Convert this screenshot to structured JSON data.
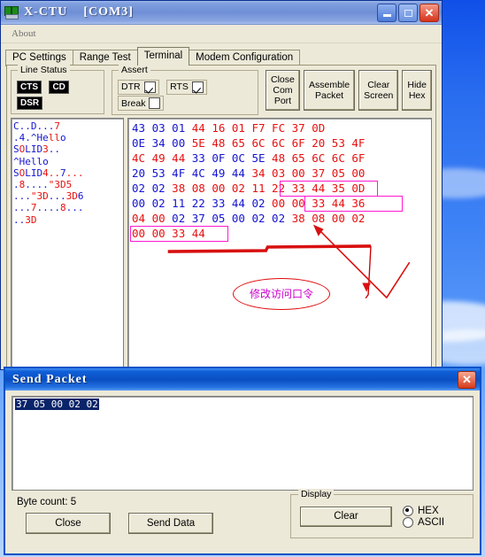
{
  "window": {
    "title": "X-CTU    [COM3]",
    "icon": "modem-icon",
    "buttons": {
      "minimize": "_",
      "maximize": "□",
      "close": "✕"
    }
  },
  "menu": {
    "items": [
      "About"
    ]
  },
  "tabs": [
    {
      "label": "PC Settings",
      "active": false
    },
    {
      "label": "Range Test",
      "active": false
    },
    {
      "label": "Terminal",
      "active": true
    },
    {
      "label": "Modem Configuration",
      "active": false
    }
  ],
  "line_status": {
    "legend": "Line Status",
    "indicators": [
      {
        "label": "CTS",
        "on": false
      },
      {
        "label": "CD",
        "on": false
      },
      {
        "label": "DSR",
        "on": false
      }
    ]
  },
  "assert": {
    "legend": "Assert",
    "items": [
      {
        "label": "DTR",
        "checked": true
      },
      {
        "label": "RTS",
        "checked": true
      },
      {
        "label": "Break",
        "checked": false
      }
    ]
  },
  "toolbar_buttons": [
    {
      "label": "Close\nCom Port"
    },
    {
      "label": "Assemble\nPacket"
    },
    {
      "label": "Clear\nScreen"
    },
    {
      "label": "Hide\nHex"
    }
  ],
  "ascii_pane": {
    "lines": [
      [
        {
          "t": "C..D...",
          "c": "blue"
        },
        {
          "t": "7",
          "c": "red"
        }
      ],
      [
        {
          "t": ".4.^He",
          "c": "blue"
        },
        {
          "t": "ll",
          "c": "red"
        },
        {
          "t": "o",
          "c": "blue"
        }
      ],
      [
        {
          "t": "S",
          "c": "blue"
        },
        {
          "t": "O",
          "c": "red"
        },
        {
          "t": "LID",
          "c": "blue"
        },
        {
          "t": "3",
          "c": "red"
        },
        {
          "t": "..",
          "c": "blue"
        }
      ],
      [
        {
          "t": "^Hello",
          "c": "blue"
        }
      ],
      [
        {
          "t": "S",
          "c": "blue"
        },
        {
          "t": "O",
          "c": "red"
        },
        {
          "t": "LID",
          "c": "blue"
        },
        {
          "t": "4..",
          "c": "red"
        },
        {
          "t": "7",
          "c": "blue"
        },
        {
          "t": "...",
          "c": "red"
        }
      ],
      [
        {
          "t": ".",
          "c": "blue"
        },
        {
          "t": "8",
          "c": "red"
        },
        {
          "t": "....",
          "c": "blue"
        },
        {
          "t": "\"3D5",
          "c": "red"
        }
      ],
      [
        {
          "t": "...",
          "c": "blue"
        },
        {
          "t": "\"3D",
          "c": "red"
        },
        {
          "t": "...",
          "c": "blue"
        },
        {
          "t": "3D",
          "c": "red"
        },
        {
          "t": "6",
          "c": "blue"
        }
      ],
      [
        {
          "t": "...",
          "c": "blue"
        },
        {
          "t": "7",
          "c": "red"
        },
        {
          "t": "....",
          "c": "blue"
        },
        {
          "t": "8",
          "c": "red"
        },
        {
          "t": "...",
          "c": "blue"
        }
      ],
      [
        {
          "t": "..",
          "c": "blue"
        },
        {
          "t": "3D",
          "c": "red"
        }
      ]
    ]
  },
  "hex_pane": {
    "rows": [
      [
        {
          "v": "43",
          "c": "blue"
        },
        {
          "v": "03",
          "c": "blue"
        },
        {
          "v": "01",
          "c": "blue"
        },
        {
          "v": "44",
          "c": "red"
        },
        {
          "v": "16",
          "c": "red"
        },
        {
          "v": "01",
          "c": "red"
        },
        {
          "v": "F7",
          "c": "red"
        },
        {
          "v": "FC",
          "c": "red"
        },
        {
          "v": "37",
          "c": "red"
        },
        {
          "v": "0D",
          "c": "red"
        }
      ],
      [
        {
          "v": "0E",
          "c": "blue"
        },
        {
          "v": "34",
          "c": "blue"
        },
        {
          "v": "00",
          "c": "blue"
        },
        {
          "v": "5E",
          "c": "red"
        },
        {
          "v": "48",
          "c": "red"
        },
        {
          "v": "65",
          "c": "red"
        },
        {
          "v": "6C",
          "c": "red"
        },
        {
          "v": "6C",
          "c": "red"
        },
        {
          "v": "6F",
          "c": "red"
        },
        {
          "v": "20",
          "c": "red"
        },
        {
          "v": "53",
          "c": "red"
        },
        {
          "v": "4F",
          "c": "red"
        }
      ],
      [
        {
          "v": "4C",
          "c": "red"
        },
        {
          "v": "49",
          "c": "red"
        },
        {
          "v": "44",
          "c": "red"
        },
        {
          "v": "33",
          "c": "blue"
        },
        {
          "v": "0F",
          "c": "blue"
        },
        {
          "v": "0C",
          "c": "blue"
        },
        {
          "v": "5E",
          "c": "blue"
        },
        {
          "v": "48",
          "c": "red"
        },
        {
          "v": "65",
          "c": "red"
        },
        {
          "v": "6C",
          "c": "red"
        },
        {
          "v": "6C",
          "c": "red"
        },
        {
          "v": "6F",
          "c": "red"
        }
      ],
      [
        {
          "v": "20",
          "c": "blue"
        },
        {
          "v": "53",
          "c": "blue"
        },
        {
          "v": "4F",
          "c": "blue"
        },
        {
          "v": "4C",
          "c": "blue"
        },
        {
          "v": "49",
          "c": "blue"
        },
        {
          "v": "44",
          "c": "blue"
        },
        {
          "v": "34",
          "c": "red"
        },
        {
          "v": "03",
          "c": "red"
        },
        {
          "v": "00",
          "c": "red"
        },
        {
          "v": "37",
          "c": "red"
        },
        {
          "v": "05",
          "c": "red"
        },
        {
          "v": "00",
          "c": "red"
        }
      ],
      [
        {
          "v": "02",
          "c": "blue"
        },
        {
          "v": "02",
          "c": "blue"
        },
        {
          "v": "38",
          "c": "red"
        },
        {
          "v": "08",
          "c": "red"
        },
        {
          "v": "00",
          "c": "red"
        },
        {
          "v": "02",
          "c": "red"
        },
        {
          "v": "11",
          "c": "red"
        },
        {
          "v": "22",
          "c": "red"
        },
        {
          "v": "33",
          "c": "red"
        },
        {
          "v": "44",
          "c": "red"
        },
        {
          "v": "35",
          "c": "red"
        },
        {
          "v": "0D",
          "c": "red"
        }
      ],
      [
        {
          "v": "00",
          "c": "blue"
        },
        {
          "v": "02",
          "c": "blue"
        },
        {
          "v": "11",
          "c": "blue"
        },
        {
          "v": "22",
          "c": "blue"
        },
        {
          "v": "33",
          "c": "blue"
        },
        {
          "v": "44",
          "c": "blue"
        },
        {
          "v": "02",
          "c": "blue"
        },
        {
          "v": "00",
          "c": "red"
        },
        {
          "v": "00",
          "c": "red"
        },
        {
          "v": "33",
          "c": "red"
        },
        {
          "v": "44",
          "c": "red"
        },
        {
          "v": "36",
          "c": "red"
        }
      ],
      [
        {
          "v": "04",
          "c": "red"
        },
        {
          "v": "00",
          "c": "red"
        },
        {
          "v": "02",
          "c": "blue"
        },
        {
          "v": "37",
          "c": "blue"
        },
        {
          "v": "05",
          "c": "blue"
        },
        {
          "v": "00",
          "c": "blue"
        },
        {
          "v": "02",
          "c": "blue"
        },
        {
          "v": "02",
          "c": "blue"
        },
        {
          "v": "38",
          "c": "red"
        },
        {
          "v": "08",
          "c": "red"
        },
        {
          "v": "00",
          "c": "red"
        },
        {
          "v": "02",
          "c": "red"
        }
      ],
      [
        {
          "v": "00",
          "c": "red"
        },
        {
          "v": "00",
          "c": "red"
        },
        {
          "v": "33",
          "c": "red"
        },
        {
          "v": "44",
          "c": "red"
        }
      ]
    ],
    "highlights": [
      {
        "name": "new-password-row5",
        "row": 4,
        "start": 6,
        "len": 4
      },
      {
        "name": "new-password-row6",
        "row": 5,
        "start": 7,
        "len": 4
      },
      {
        "name": "new-password-row8",
        "row": 7,
        "start": 0,
        "len": 4
      }
    ]
  },
  "annotation": {
    "label": "修改访问口令",
    "color": "#cc00cc",
    "ellipse_color": "#e10a0a"
  },
  "send_dialog": {
    "title": "Send Packet",
    "close_label": "✕",
    "packet_value": "37 05 00 02 02",
    "byte_count_label": "Byte count: 5",
    "close_button": "Close",
    "send_button": "Send Data",
    "display": {
      "legend": "Display",
      "clear_button": "Clear",
      "options": [
        {
          "label": "HEX",
          "selected": true
        },
        {
          "label": "ASCII",
          "selected": false
        }
      ]
    }
  }
}
